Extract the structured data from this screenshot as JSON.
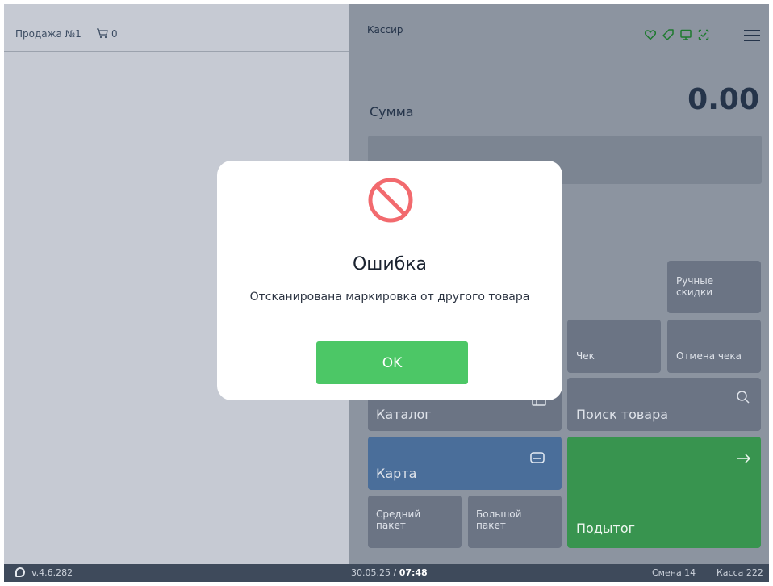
{
  "left_panel": {
    "sale_title": "Продажа №1",
    "cart_count": "0"
  },
  "right_panel": {
    "cashier_label": "Кассир",
    "top_icons": [
      "heart-icon",
      "tag-icon",
      "monitor-icon",
      "check-circle-icon",
      "menu-icon"
    ],
    "sum_label": "Сумма",
    "sum_value": "0.00",
    "tiles": {
      "manual_discounts": "Ручные скидки",
      "check": "Чек",
      "cancel_check": "Отмена чека",
      "catalog": "Каталог",
      "product_search": "Поиск товара",
      "card": "Карта",
      "medium_bag": "Средний пакет",
      "large_bag": "Большой пакет",
      "subtotal": "Подытог"
    }
  },
  "status_bar": {
    "version": "v.4.6.282",
    "date": "30.05.25 /",
    "time": "07:48",
    "shift": "Смена 14",
    "kassa": "Касса 222"
  },
  "modal": {
    "title": "Ошибка",
    "message": "Отсканирована маркировка от другого товара",
    "ok_label": "OK"
  },
  "colors": {
    "accent_green": "#4cc766",
    "subtotal_green": "#38944f",
    "card_blue": "#4a6e9a",
    "error_red": "#f26a6e"
  }
}
